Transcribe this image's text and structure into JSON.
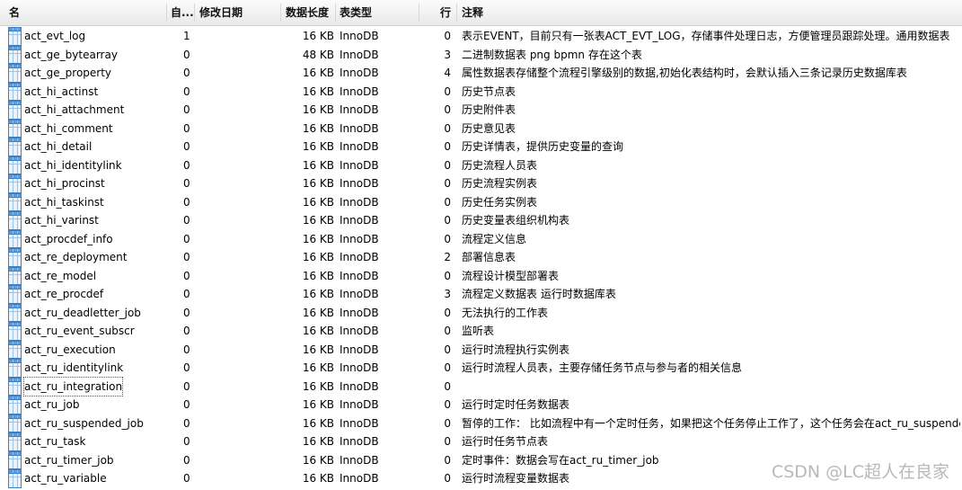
{
  "columns": [
    "名",
    "自...",
    "修改日期",
    "数据长度",
    "表类型",
    "行",
    "注释"
  ],
  "rows": [
    {
      "name": "act_evt_log",
      "auto": "1",
      "size": "16 KB",
      "engine": "InnoDB",
      "rows": "0",
      "comment": "表示EVENT，目前只有一张表ACT_EVT_LOG，存储事件处理日志，方便管理员跟踪处理。通用数据表"
    },
    {
      "name": "act_ge_bytearray",
      "auto": "0",
      "size": "48 KB",
      "engine": "InnoDB",
      "rows": "3",
      "comment": "二进制数据表  png  bpmn 存在这个表"
    },
    {
      "name": "act_ge_property",
      "auto": "0",
      "size": "16 KB",
      "engine": "InnoDB",
      "rows": "4",
      "comment": "属性数据表存储整个流程引擎级别的数据,初始化表结构时，会默认插入三条记录历史数据库表"
    },
    {
      "name": "act_hi_actinst",
      "auto": "0",
      "size": "16 KB",
      "engine": "InnoDB",
      "rows": "0",
      "comment": " 历史节点表"
    },
    {
      "name": "act_hi_attachment",
      "auto": "0",
      "size": "16 KB",
      "engine": "InnoDB",
      "rows": "0",
      "comment": "历史附件表"
    },
    {
      "name": "act_hi_comment",
      "auto": "0",
      "size": "16 KB",
      "engine": "InnoDB",
      "rows": "0",
      "comment": "历史意见表"
    },
    {
      "name": "act_hi_detail",
      "auto": "0",
      "size": "16 KB",
      "engine": "InnoDB",
      "rows": "0",
      "comment": "历史详情表，提供历史变量的查询"
    },
    {
      "name": "act_hi_identitylink",
      "auto": "0",
      "size": "16 KB",
      "engine": "InnoDB",
      "rows": "0",
      "comment": "历史流程人员表"
    },
    {
      "name": "act_hi_procinst",
      "auto": "0",
      "size": "16 KB",
      "engine": "InnoDB",
      "rows": "0",
      "comment": " 历史流程实例表"
    },
    {
      "name": "act_hi_taskinst",
      "auto": "0",
      "size": "16 KB",
      "engine": "InnoDB",
      "rows": "0",
      "comment": "历史任务实例表"
    },
    {
      "name": "act_hi_varinst",
      "auto": "0",
      "size": "16 KB",
      "engine": "InnoDB",
      "rows": "0",
      "comment": "历史变量表组织机构表"
    },
    {
      "name": "act_procdef_info",
      "auto": "0",
      "size": "16 KB",
      "engine": "InnoDB",
      "rows": "0",
      "comment": "流程定义信息"
    },
    {
      "name": "act_re_deployment",
      "auto": "0",
      "size": "16 KB",
      "engine": "InnoDB",
      "rows": "2",
      "comment": "部署信息表"
    },
    {
      "name": "act_re_model",
      "auto": "0",
      "size": "16 KB",
      "engine": "InnoDB",
      "rows": "0",
      "comment": "流程设计模型部署表"
    },
    {
      "name": "act_re_procdef",
      "auto": "0",
      "size": "16 KB",
      "engine": "InnoDB",
      "rows": "3",
      "comment": "流程定义数据表  运行时数据库表"
    },
    {
      "name": "act_ru_deadletter_job",
      "auto": "0",
      "size": "16 KB",
      "engine": "InnoDB",
      "rows": "0",
      "comment": "无法执行的工作表"
    },
    {
      "name": "act_ru_event_subscr",
      "auto": "0",
      "size": "16 KB",
      "engine": "InnoDB",
      "rows": "0",
      "comment": " 监听表"
    },
    {
      "name": "act_ru_execution",
      "auto": "0",
      "size": "16 KB",
      "engine": "InnoDB",
      "rows": "0",
      "comment": "运行时流程执行实例表"
    },
    {
      "name": "act_ru_identitylink",
      "auto": "0",
      "size": "16 KB",
      "engine": "InnoDB",
      "rows": "0",
      "comment": "运行时流程人员表，主要存储任务节点与参与者的相关信息"
    },
    {
      "name": "act_ru_integration",
      "auto": "0",
      "size": "16 KB",
      "engine": "InnoDB",
      "rows": "0",
      "comment": ""
    },
    {
      "name": "act_ru_job",
      "auto": "0",
      "size": "16 KB",
      "engine": "InnoDB",
      "rows": "0",
      "comment": "运行时定时任务数据表"
    },
    {
      "name": "act_ru_suspended_job",
      "auto": "0",
      "size": "16 KB",
      "engine": "InnoDB",
      "rows": "0",
      "comment": "暂停的工作：  比如流程中有一个定时任务，如果把这个任务停止工作了，这个任务会在act_ru_suspende..."
    },
    {
      "name": "act_ru_task",
      "auto": "0",
      "size": "16 KB",
      "engine": "InnoDB",
      "rows": "0",
      "comment": "运行时任务节点表"
    },
    {
      "name": "act_ru_timer_job",
      "auto": "0",
      "size": "16 KB",
      "engine": "InnoDB",
      "rows": "0",
      "comment": "定时事件：数据会写在act_ru_timer_job"
    },
    {
      "name": "act_ru_variable",
      "auto": "0",
      "size": "16 KB",
      "engine": "InnoDB",
      "rows": "0",
      "comment": "运行时流程变量数据表"
    }
  ],
  "focused_row": 19,
  "watermark": "CSDN @LC超人在良家",
  "icons": {
    "table_row": "table-icon"
  },
  "colors": {
    "icon_border": "#3d7fc7",
    "icon_fill": "#eaf3fd",
    "header_bg": "#efefef"
  }
}
